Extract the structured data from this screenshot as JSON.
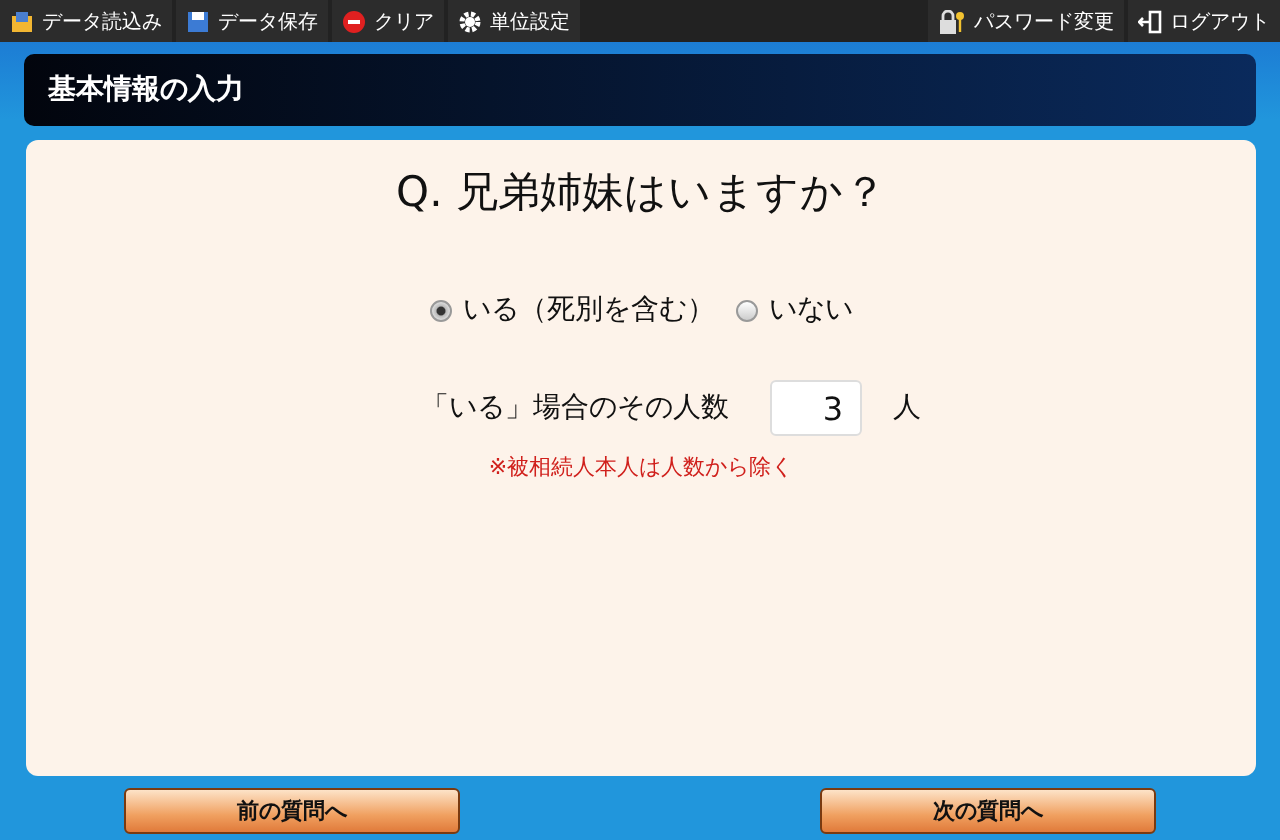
{
  "toolbar": {
    "left": [
      {
        "kind": "load",
        "label": "データ読込み"
      },
      {
        "kind": "save",
        "label": "データ保存"
      },
      {
        "kind": "clear",
        "label": "クリア"
      },
      {
        "kind": "settings",
        "label": "単位設定"
      }
    ],
    "right": [
      {
        "kind": "password",
        "label": "パスワード変更"
      },
      {
        "kind": "logout",
        "label": "ログアウト"
      }
    ]
  },
  "section_title": "基本情報の入力",
  "question": "Q. 兄弟姉妹はいますか？",
  "options": [
    {
      "label": "いる（死別を含む）",
      "selected": true
    },
    {
      "label": "いない",
      "selected": false
    }
  ],
  "count_field": {
    "label": "「いる」場合のその人数",
    "value": "3",
    "unit": "人"
  },
  "note": "※被相続人本人は人数から除く",
  "nav_buttons": [
    "前の質問へ",
    "次の質問へ"
  ]
}
